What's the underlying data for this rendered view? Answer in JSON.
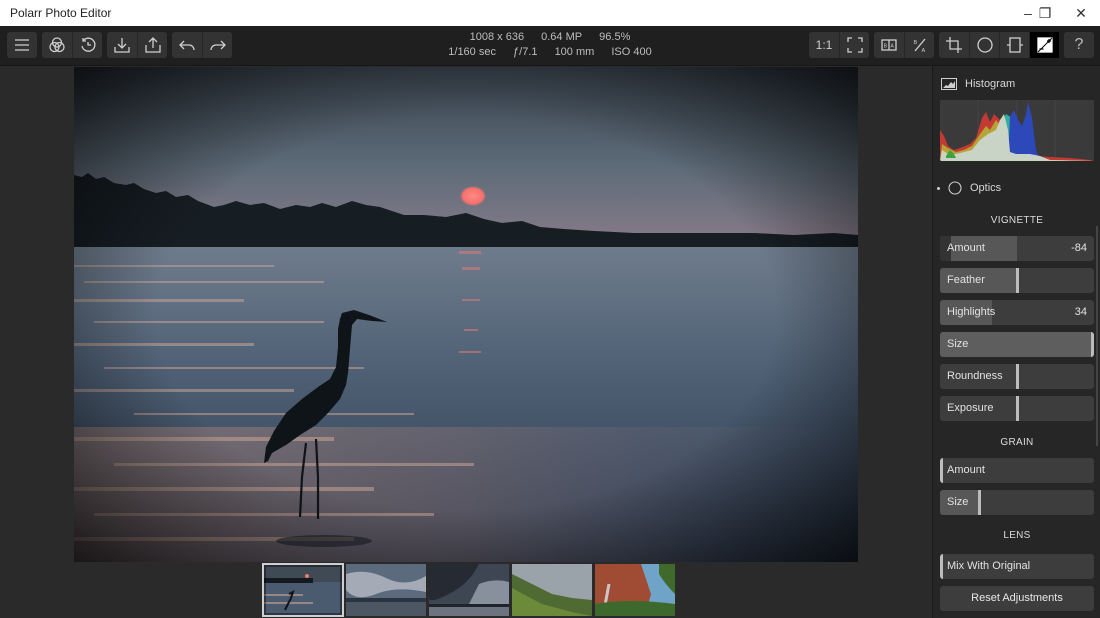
{
  "window": {
    "title": "Polarr Photo Editor",
    "controls": {
      "minimize": "–",
      "restore": "❐",
      "close": "✕"
    }
  },
  "toolbar": {
    "left_groups": [
      [
        {
          "name": "menu-button",
          "icon": "hamburger-icon"
        }
      ],
      [
        {
          "name": "filters-button",
          "icon": "color-circles-icon"
        },
        {
          "name": "history-button",
          "icon": "history-icon"
        }
      ],
      [
        {
          "name": "import-button",
          "icon": "download-icon"
        },
        {
          "name": "export-button",
          "icon": "share-icon"
        }
      ],
      [
        {
          "name": "undo-button",
          "icon": "undo-arrow-icon"
        },
        {
          "name": "redo-button",
          "icon": "redo-arrow-icon"
        }
      ]
    ],
    "zoom_label": "1:1",
    "right_buttons": [
      "fullscreen-button",
      "compare-side-button",
      "compare-split-button",
      "crop-button",
      "local-adjust-button",
      "frame-button",
      "adjust-button",
      "help-button"
    ],
    "help_label": "?",
    "active_tool": "adjust-button"
  },
  "image_info": {
    "dimensions": "1008 x 636",
    "megapixels": "0.64 MP",
    "zoom": "96.5%",
    "shutter": "1/160 sec",
    "aperture": "ƒ/7.1",
    "focal_length": "100 mm",
    "iso": "ISO 400"
  },
  "filmstrip": {
    "thumbnails": [
      {
        "subject": "heron at sunset",
        "selected": true
      },
      {
        "subject": "clouds over lake",
        "selected": false
      },
      {
        "subject": "stormy sky over water",
        "selected": false
      },
      {
        "subject": "green mountains",
        "selected": false
      },
      {
        "subject": "red cliff waterfall",
        "selected": false
      }
    ]
  },
  "panel": {
    "histogram_label": "Histogram",
    "optics_label": "Optics",
    "sections": [
      {
        "title": "VIGNETTE",
        "sliders": [
          {
            "label": "Amount",
            "value": "-84",
            "level": -0.84
          },
          {
            "label": "Feather",
            "value": "",
            "level": 0
          },
          {
            "label": "Highlights",
            "value": "34",
            "level": 0.34
          },
          {
            "label": "Size",
            "value": "",
            "level": 1.0
          },
          {
            "label": "Roundness",
            "value": "",
            "level": 0
          },
          {
            "label": "Exposure",
            "value": "",
            "level": 0
          }
        ]
      },
      {
        "title": "GRAIN",
        "sliders": [
          {
            "label": "Amount",
            "value": "",
            "level": 0
          },
          {
            "label": "Size",
            "value": "",
            "level": 0.25
          }
        ]
      },
      {
        "title": "LENS",
        "sliders": [
          {
            "label": "Mix With Original",
            "value": "",
            "level": 0
          }
        ]
      }
    ],
    "reset_label": "Reset Adjustments"
  },
  "colors": {
    "toolbar_bg": "#1f1f1f",
    "panel_bg": "#262626",
    "slider_bg": "#3d3d3d",
    "slider_fill": "#575757",
    "active_tool_bg": "#000000"
  }
}
